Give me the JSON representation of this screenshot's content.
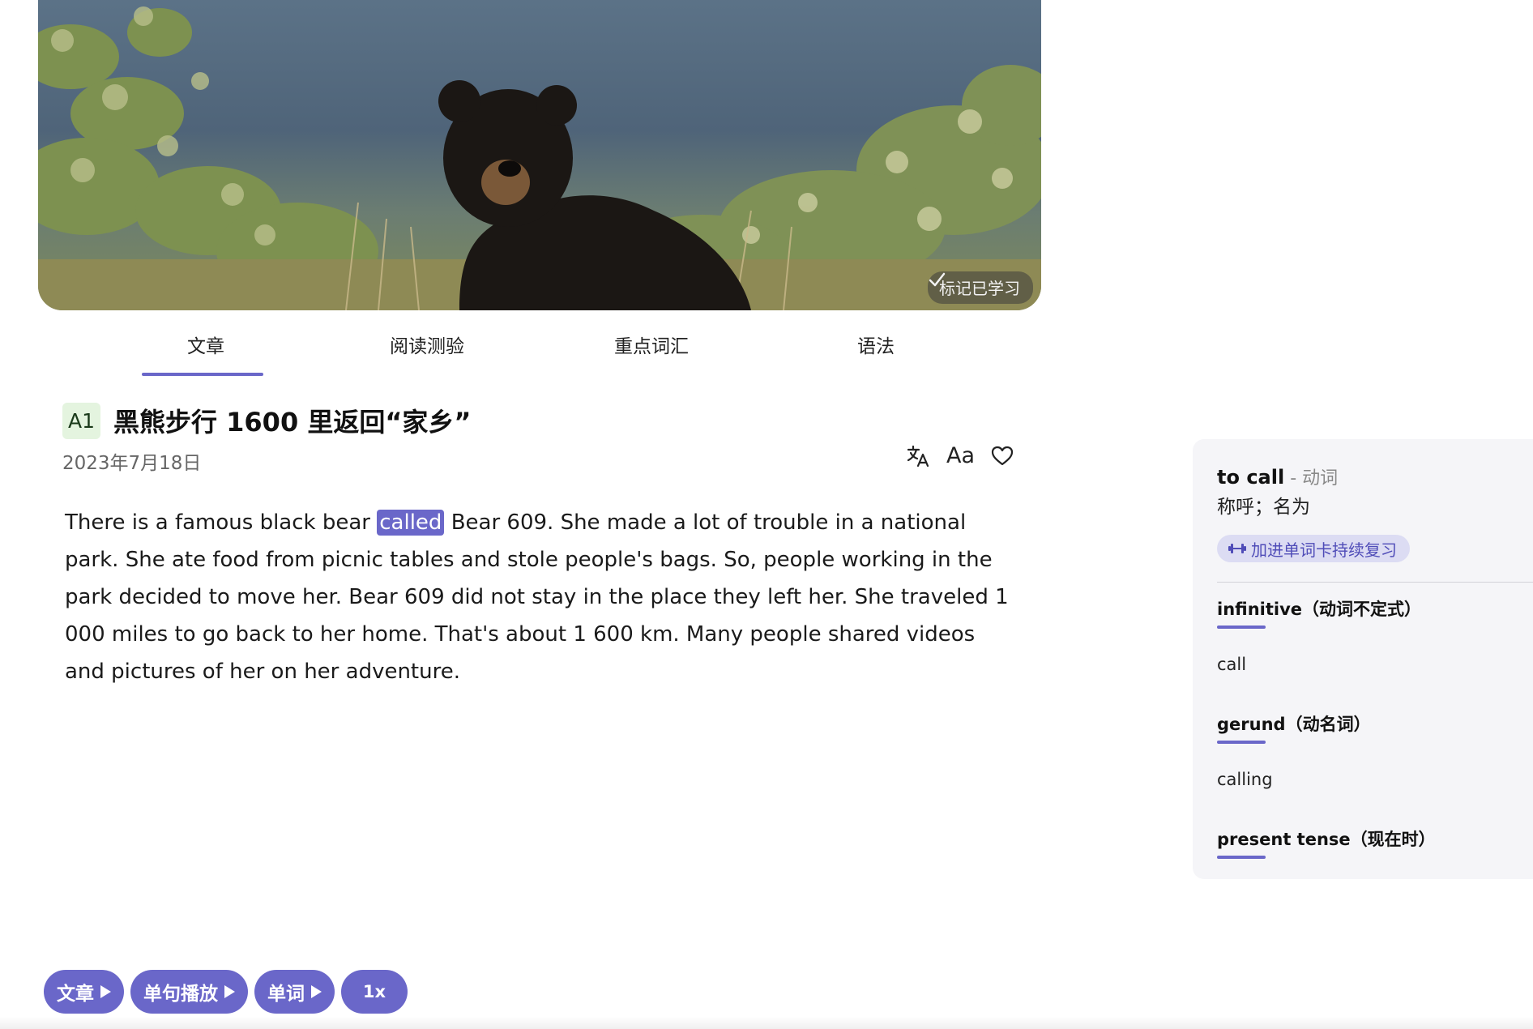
{
  "hero": {
    "mark_learned_label": "标记已学习"
  },
  "tabs": [
    {
      "label": "文章",
      "active": true
    },
    {
      "label": "阅读测验",
      "active": false
    },
    {
      "label": "重点词汇",
      "active": false
    },
    {
      "label": "语法",
      "active": false
    }
  ],
  "article": {
    "level": "A1",
    "title": "黑熊步行 1600 里返回“家乡”",
    "date": "2023年7月18日",
    "font_size_label": "Aa",
    "text_before": "There is a famous black bear ",
    "highlighted_word": "called",
    "text_after": " Bear 609. She made a lot of trouble in a national park. She ate food from picnic tables and stole people's bags. So, people working in the park decided to move her. Bear 609 did not stay in the place they left her. She traveled 1 000 miles to go back to her home. That's about 1 600 km. Many people shared videos and pictures of her on her adventure."
  },
  "player": {
    "article_label": "文章",
    "sentence_label": "单句播放",
    "word_label": "单词",
    "speed_label": "1x"
  },
  "word_panel": {
    "word": "to call",
    "pos": " - 动词",
    "meaning": "称呼；名为",
    "add_label": "加进单词卡持续复习",
    "forms": [
      {
        "heading": "infinitive（动词不定式）",
        "value": "call"
      },
      {
        "heading": "gerund（动名词）",
        "value": "calling"
      },
      {
        "heading": "present tense（现在时）",
        "value": ""
      }
    ]
  },
  "colors": {
    "accent": "#6a67c9",
    "level_badge_bg": "#e4f4df",
    "panel_bg": "#f5f5f8"
  },
  "icons": [
    "check-icon",
    "translate-icon",
    "heart-icon",
    "play-icon",
    "dumbbell-icon"
  ]
}
